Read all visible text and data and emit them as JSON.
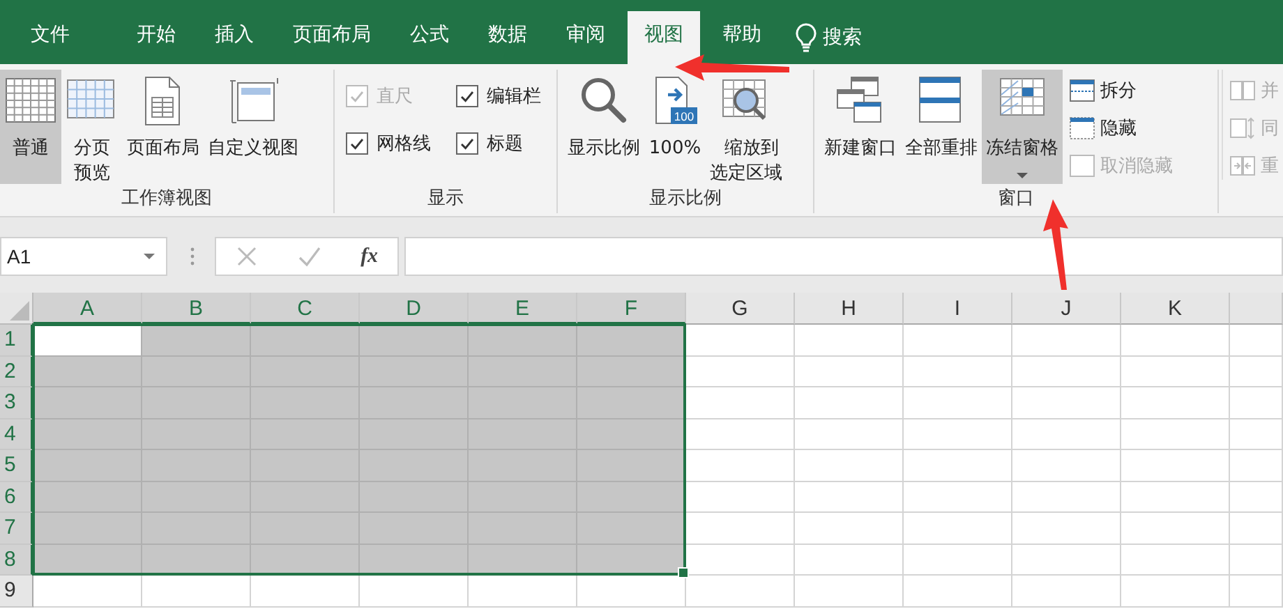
{
  "tabs": [
    {
      "label": "文件",
      "selected": false
    },
    {
      "label": "开始",
      "selected": false
    },
    {
      "label": "插入",
      "selected": false
    },
    {
      "label": "页面布局",
      "selected": false
    },
    {
      "label": "公式",
      "selected": false
    },
    {
      "label": "数据",
      "selected": false
    },
    {
      "label": "审阅",
      "selected": false
    },
    {
      "label": "视图",
      "selected": true
    },
    {
      "label": "帮助",
      "selected": false
    }
  ],
  "search": {
    "label": "搜索"
  },
  "ribbon_groups": [
    {
      "label": "工作簿视图",
      "items": [
        {
          "kind": "large",
          "label": "普通",
          "highlighted": true
        },
        {
          "kind": "large",
          "label": "分页预览",
          "highlighted": false
        },
        {
          "kind": "large",
          "label": "页面布局",
          "highlighted": false
        },
        {
          "kind": "large",
          "label": "自定义视图",
          "highlighted": false
        }
      ]
    },
    {
      "label": "显示",
      "items": [
        {
          "kind": "check",
          "label": "直尺",
          "checked": true,
          "disabled": true
        },
        {
          "kind": "check",
          "label": "编辑栏",
          "checked": true,
          "disabled": false
        },
        {
          "kind": "check",
          "label": "网格线",
          "checked": true,
          "disabled": false
        },
        {
          "kind": "check",
          "label": "标题",
          "checked": true,
          "disabled": false
        }
      ]
    },
    {
      "label": "显示比例",
      "items": [
        {
          "kind": "large",
          "label": "显示比例",
          "highlighted": false
        },
        {
          "kind": "large",
          "label": "100%",
          "badge": "100",
          "highlighted": false
        },
        {
          "kind": "large",
          "label": "缩放到选定区域",
          "highlighted": false
        }
      ]
    },
    {
      "label": "窗口",
      "items": [
        {
          "kind": "large",
          "label": "新建窗口",
          "highlighted": false
        },
        {
          "kind": "large",
          "label": "全部重排",
          "highlighted": false
        },
        {
          "kind": "large",
          "label": "冻结窗格",
          "highlighted": true,
          "dropdown": true
        },
        {
          "kind": "small",
          "label": "拆分",
          "disabled": false
        },
        {
          "kind": "small",
          "label": "隐藏",
          "disabled": false
        },
        {
          "kind": "small",
          "label": "取消隐藏",
          "disabled": true
        }
      ]
    },
    {
      "items": [
        {
          "kind": "small",
          "label": "并",
          "disabled": true
        },
        {
          "kind": "small",
          "label": "同",
          "disabled": true
        },
        {
          "kind": "small",
          "label": "重",
          "disabled": true
        }
      ]
    }
  ],
  "formula_bar": {
    "name_box": "A1",
    "function_label": "fx"
  },
  "sheet": {
    "columns": [
      {
        "label": "A",
        "selected": true,
        "active": true
      },
      {
        "label": "B",
        "selected": true,
        "active": false
      },
      {
        "label": "C",
        "selected": true,
        "active": false
      },
      {
        "label": "D",
        "selected": true,
        "active": false
      },
      {
        "label": "E",
        "selected": true,
        "active": false
      },
      {
        "label": "F",
        "selected": true,
        "active": false
      },
      {
        "label": "G",
        "selected": false,
        "active": false
      },
      {
        "label": "H",
        "selected": false,
        "active": false
      },
      {
        "label": "I",
        "selected": false,
        "active": false
      },
      {
        "label": "J",
        "selected": false,
        "active": false
      },
      {
        "label": "K",
        "selected": false,
        "active": false
      }
    ],
    "rows": [
      {
        "label": "1",
        "selected": true,
        "active": true
      },
      {
        "label": "2",
        "selected": true,
        "active": false
      },
      {
        "label": "3",
        "selected": true,
        "active": false
      },
      {
        "label": "4",
        "selected": true,
        "active": false
      },
      {
        "label": "5",
        "selected": true,
        "active": false
      },
      {
        "label": "6",
        "selected": true,
        "active": false
      },
      {
        "label": "7",
        "selected": true,
        "active": false
      },
      {
        "label": "8",
        "selected": true,
        "active": false
      },
      {
        "label": "9",
        "selected": false,
        "active": false
      }
    ]
  },
  "annotations": [
    {
      "kind": "arrow"
    },
    {
      "kind": "arrow"
    }
  ]
}
